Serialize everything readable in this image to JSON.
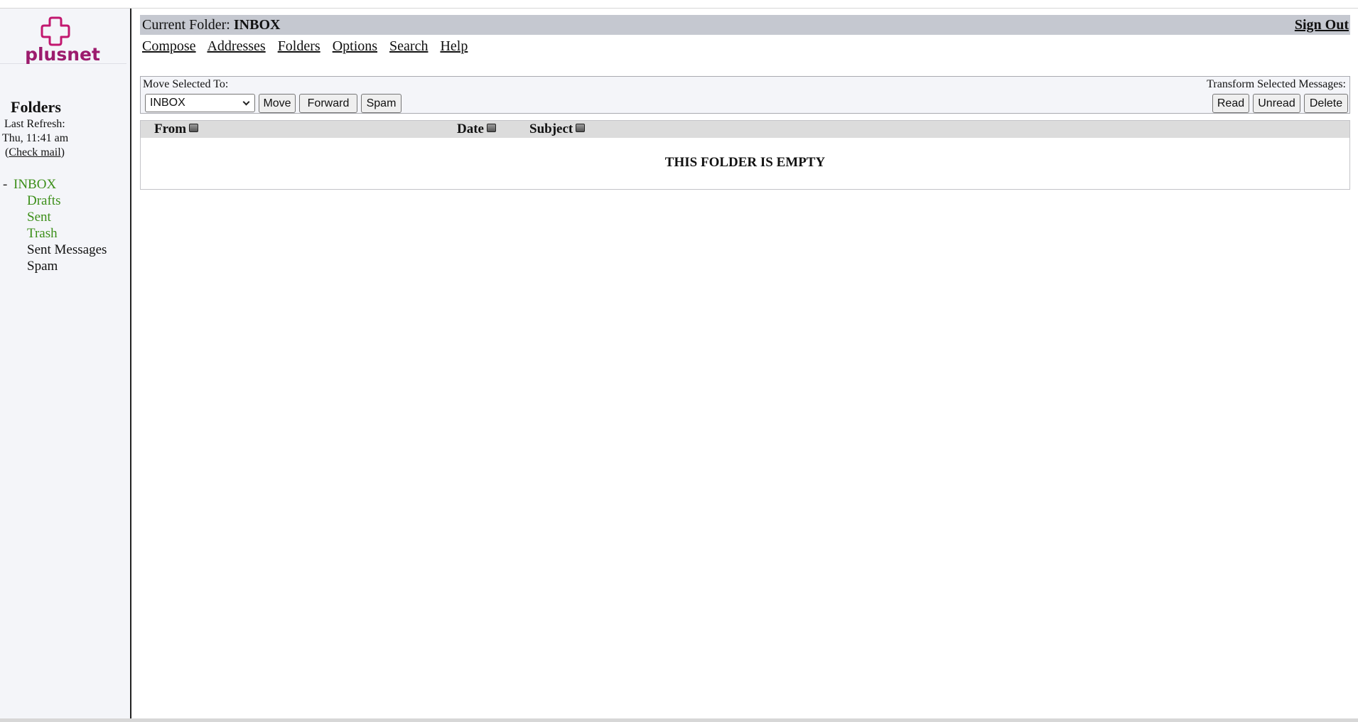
{
  "brand": {
    "name": "plusnet",
    "color": "#9c1b6d"
  },
  "sidebar": {
    "title": "Folders",
    "last_refresh_label": "Last Refresh:",
    "last_refresh_time": "Thu, 11:41 am",
    "check_mail_open": "(",
    "check_mail_label": "Check mail",
    "check_mail_close": ")",
    "current_marker": "-",
    "folders": [
      {
        "label": "INBOX",
        "color": "#3c8f19"
      },
      {
        "label": "Drafts",
        "color": "#3c8f19"
      },
      {
        "label": "Sent",
        "color": "#3c8f19"
      },
      {
        "label": "Trash",
        "color": "#3c8f19"
      },
      {
        "label": "Sent Messages",
        "color": "#111111"
      },
      {
        "label": "Spam",
        "color": "#111111"
      }
    ]
  },
  "header": {
    "current_folder_label": "Current Folder: ",
    "current_folder": "INBOX",
    "sign_out": "Sign Out"
  },
  "nav": [
    "Compose",
    "Addresses",
    "Folders",
    "Options",
    "Search",
    "Help"
  ],
  "actions": {
    "move_label": "Move Selected To:",
    "move_target": "INBOX",
    "move_button": "Move",
    "forward_button": "Forward",
    "spam_button": "Spam",
    "transform_label": "Transform Selected Messages:",
    "read_button": "Read",
    "unread_button": "Unread",
    "delete_button": "Delete"
  },
  "table": {
    "columns": [
      "From",
      "Date",
      "Subject"
    ],
    "empty_message": "THIS FOLDER IS EMPTY"
  }
}
